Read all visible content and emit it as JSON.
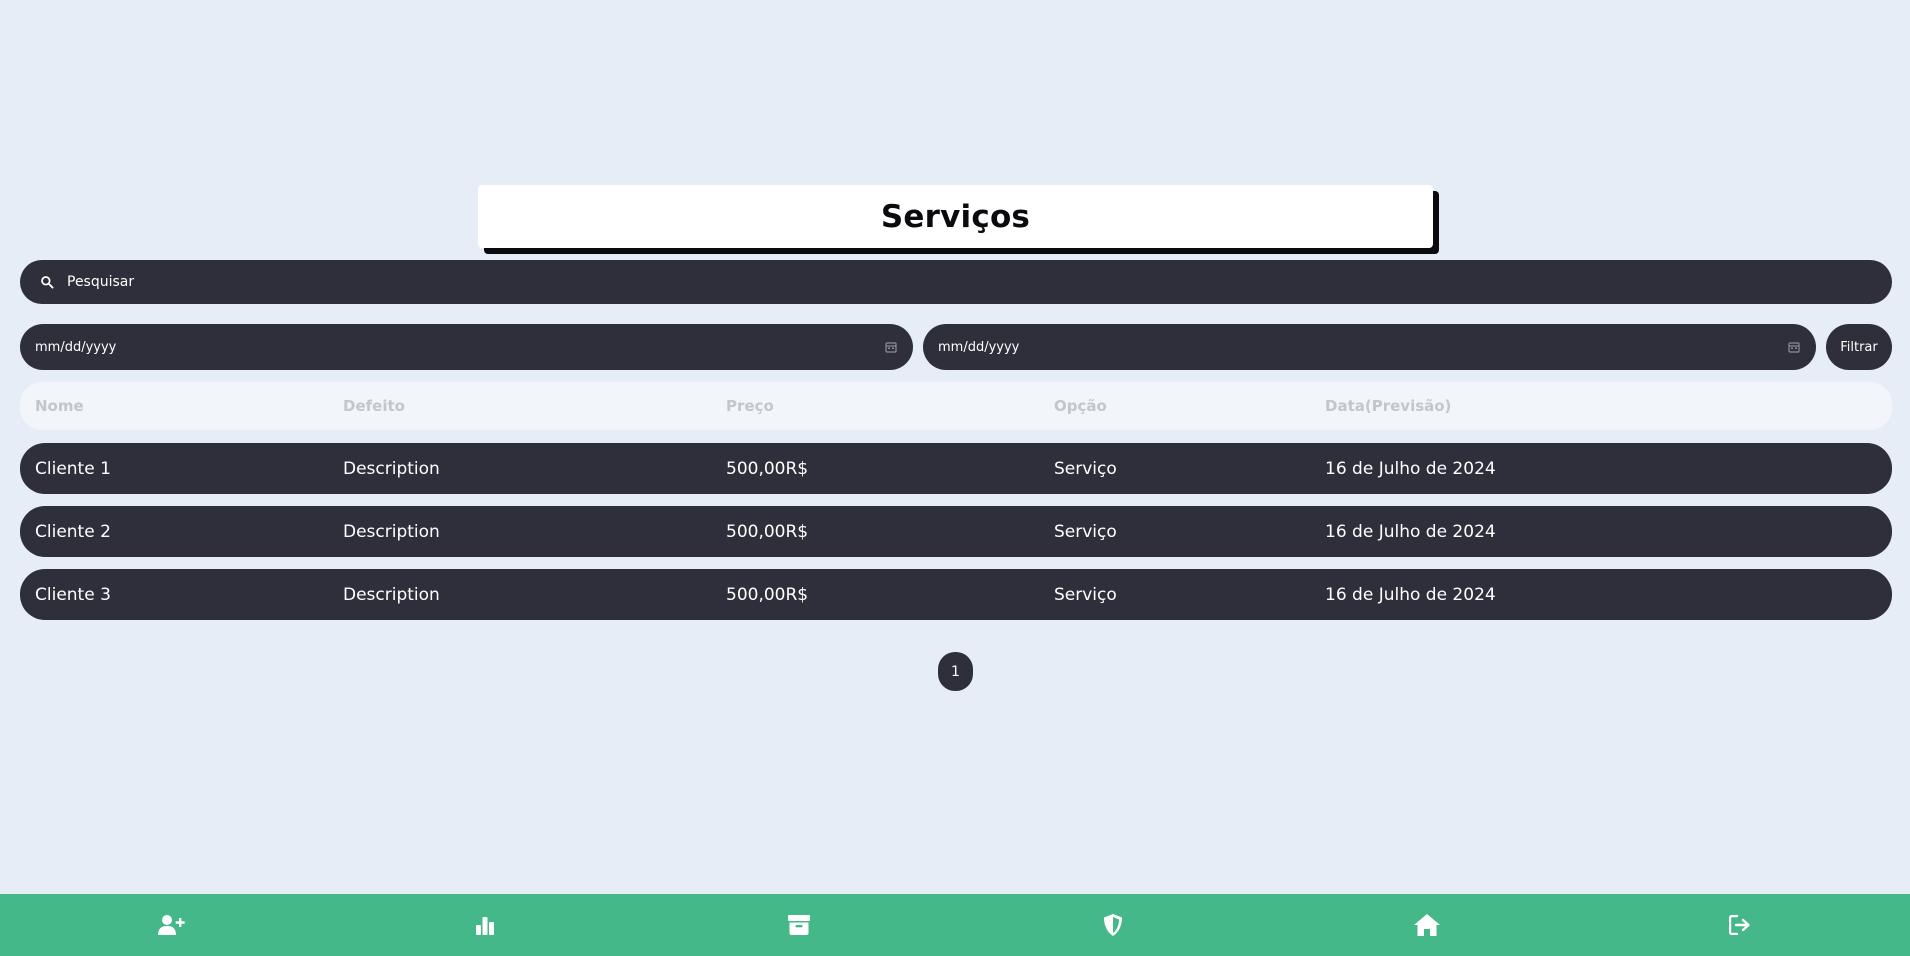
{
  "header": {
    "title": "Serviços"
  },
  "search": {
    "placeholder": "Pesquisar",
    "icon": "search-icon"
  },
  "filters": {
    "start_date_placeholder": "mm/dd/yyyy",
    "end_date_placeholder": "mm/dd/yyyy",
    "filter_label": "Filtrar"
  },
  "table": {
    "columns": [
      "Nome",
      "Defeito",
      "Preço",
      "Opção",
      "Data(Previsão)"
    ],
    "rows": [
      [
        "Cliente 1",
        "Description",
        "500,00R$",
        "Serviço",
        "16 de Julho de 2024"
      ],
      [
        "Cliente 2",
        "Description",
        "500,00R$",
        "Serviço",
        "16 de Julho de 2024"
      ],
      [
        "Cliente 3",
        "Description",
        "500,00R$",
        "Serviço",
        "16 de Julho de 2024"
      ]
    ]
  },
  "pagination": {
    "current": "1"
  },
  "nav": {
    "items": [
      "add-user-icon",
      "bar-chart-icon",
      "archive-icon",
      "shield-icon",
      "home-icon",
      "logout-icon"
    ]
  },
  "colors": {
    "background": "#e6edf7",
    "dark": "#2e2f3a",
    "nav": "#44b888",
    "header_row": "#f2f5fa"
  }
}
